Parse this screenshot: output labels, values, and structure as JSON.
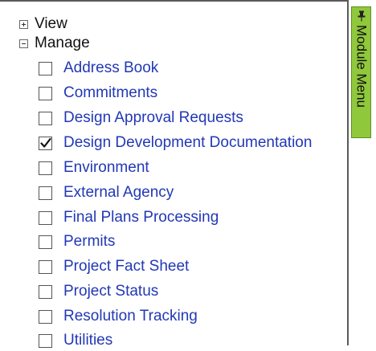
{
  "tree": {
    "view": {
      "label": "View",
      "icon": "expand-plus-icon"
    },
    "manage": {
      "label": "Manage",
      "icon": "collapse-minus-icon"
    }
  },
  "items": [
    {
      "label": "Address Book",
      "checked": false
    },
    {
      "label": "Commitments",
      "checked": false
    },
    {
      "label": "Design Approval Requests",
      "checked": false
    },
    {
      "label": "Design Development Documentation",
      "checked": true
    },
    {
      "label": "Environment",
      "checked": false
    },
    {
      "label": "External Agency",
      "checked": false
    },
    {
      "label": "Final Plans Processing",
      "checked": false
    },
    {
      "label": "Permits",
      "checked": false
    },
    {
      "label": "Project Fact Sheet",
      "checked": false
    },
    {
      "label": "Project Status",
      "checked": false
    },
    {
      "label": "Resolution Tracking",
      "checked": false
    },
    {
      "label": "Utilities",
      "checked": false
    }
  ],
  "module_menu": {
    "label": "Module Menu",
    "icon": "pin-icon",
    "color": "#90c83c"
  },
  "colors": {
    "link": "#2238b6",
    "border": "#5a5a5a"
  }
}
